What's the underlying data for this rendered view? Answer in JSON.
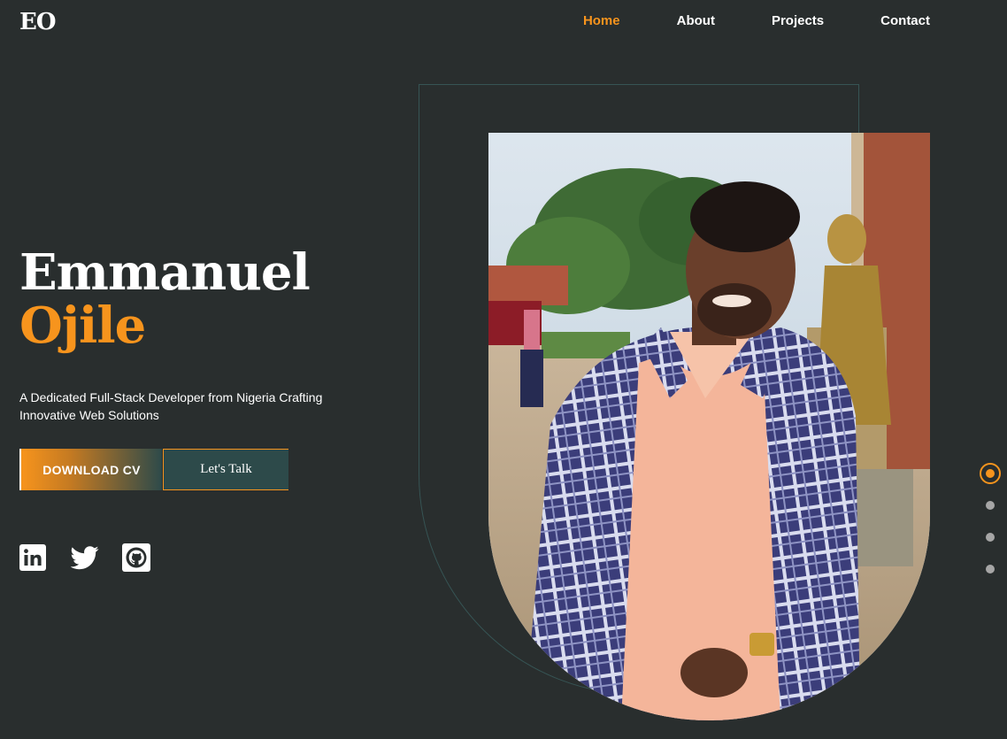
{
  "brand": {
    "logo": "EO"
  },
  "nav": {
    "items": [
      {
        "label": "Home",
        "active": true
      },
      {
        "label": "About",
        "active": false
      },
      {
        "label": "Projects",
        "active": false
      },
      {
        "label": "Contact",
        "active": false
      }
    ]
  },
  "hero": {
    "first_name": "Emmanuel",
    "last_name": "Ojile",
    "tagline": "A Dedicated Full-Stack Developer from Nigeria Crafting Innovative Web Solutions",
    "download_label": "DOWNLOAD CV",
    "talk_label": "Let's Talk"
  },
  "socials": [
    {
      "name": "linkedin-icon"
    },
    {
      "name": "twitter-icon"
    },
    {
      "name": "github-icon"
    }
  ],
  "slider": {
    "count": 4,
    "active_index": 0
  },
  "colors": {
    "background": "#292e2e",
    "accent": "#f7941d",
    "button_teal": "#2d4a4a",
    "arch_line": "#365454"
  }
}
